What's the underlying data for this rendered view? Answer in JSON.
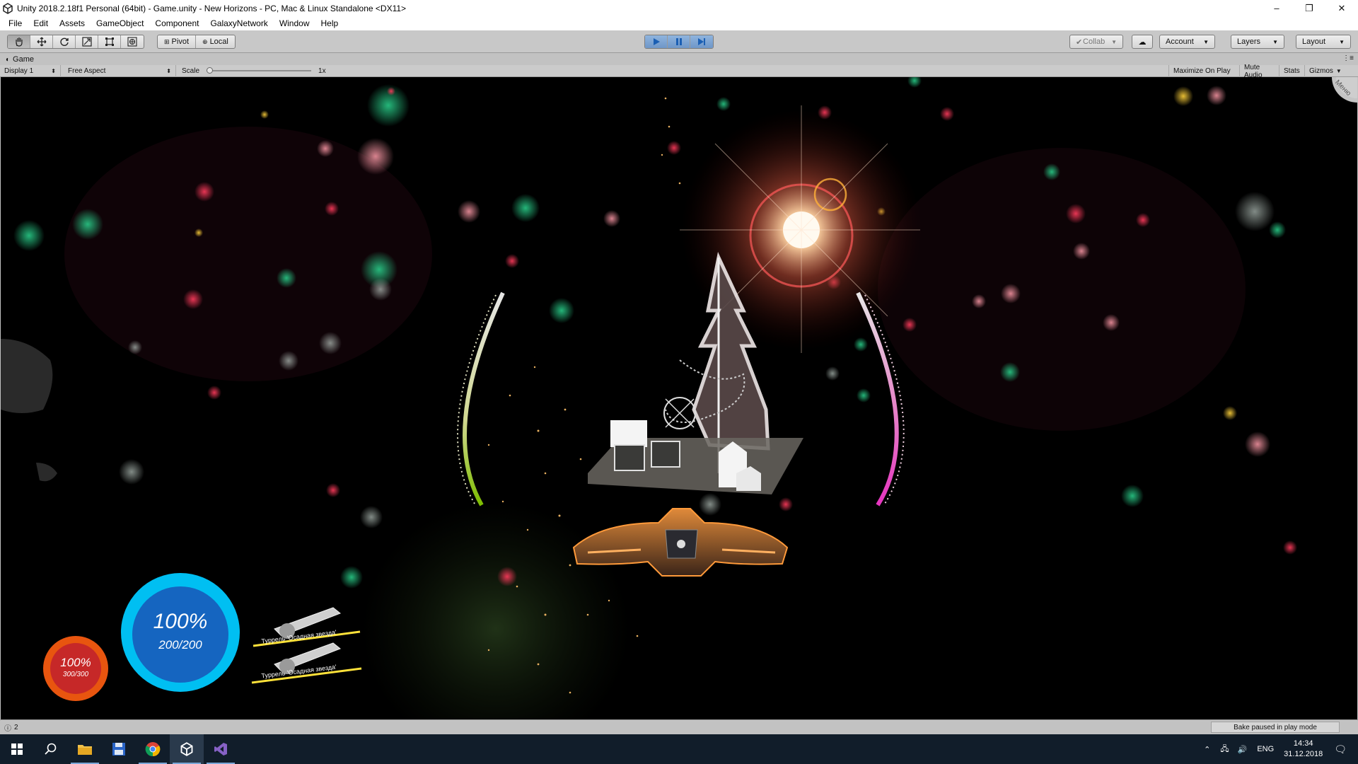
{
  "window": {
    "title": "Unity 2018.2.18f1 Personal (64bit) - Game.unity - New Horizons - PC, Mac & Linux Standalone <DX11>",
    "controls": [
      "–",
      "❐",
      "✕"
    ]
  },
  "menu": [
    "File",
    "Edit",
    "Assets",
    "GameObject",
    "Component",
    "GalaxyNetwork",
    "Window",
    "Help"
  ],
  "toolbar": {
    "tools": [
      "hand-tool-icon",
      "move-tool-icon",
      "rotate-tool-icon",
      "scale-tool-icon",
      "rect-tool-icon",
      "transform-tool-icon"
    ],
    "pivot_label": "Pivot",
    "local_label": "Local",
    "collab_label": "Collab",
    "account_label": "Account",
    "layers_label": "Layers",
    "layout_label": "Layout"
  },
  "game_tab": {
    "label": "Game"
  },
  "game_options": {
    "display": "Display 1",
    "aspect": "Free Aspect",
    "scale_label": "Scale",
    "scale_value": "1x",
    "maximize": "Maximize On Play",
    "mute": "Mute Audio",
    "stats": "Stats",
    "gizmos": "Gizmos"
  },
  "hud": {
    "menu_corner": "Меню",
    "shield_percent": "100%",
    "shield_value": "200/200",
    "hull_percent": "100%",
    "hull_value": "300/300",
    "turret_1": "Туррель 'Осадная звезда'",
    "turret_2": "Туррель 'Осадная звезда'",
    "shield_color": "#00bff2",
    "hull_color": "#e8550f"
  },
  "status": {
    "count": "2",
    "bake": "Bake paused in play mode"
  },
  "taskbar": {
    "lang": "ENG",
    "time": "14:34",
    "date": "31.12.2018"
  }
}
